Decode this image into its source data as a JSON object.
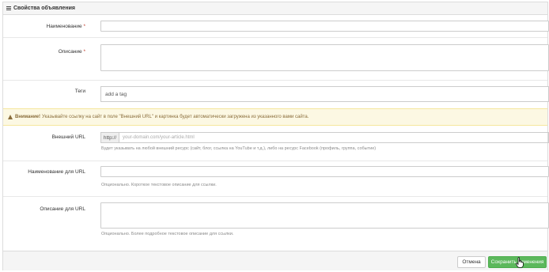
{
  "panel": {
    "title": "Свойства объявления"
  },
  "fields": {
    "name": {
      "label": "Наименование",
      "required_mark": "*",
      "value": ""
    },
    "description": {
      "label": "Описание",
      "required_mark": "*",
      "value": ""
    },
    "tags": {
      "label": "Теги",
      "placeholder": "add a tag"
    }
  },
  "alert": {
    "strong": "Внимание!",
    "text": "Указывайте ссылку на сайт в поле \"Внешний URL\" и картинка будет автоматически загружена из указанного вами сайта."
  },
  "external_url": {
    "label": "Внешний URL",
    "prefix": "http://",
    "placeholder": "your-domain.com/your-article.html",
    "help": "Будет указывать на любой внешний ресурс (сайт, блог, ссылка на YouTube и т.д.), либо на ресурс Facebook (профиль, группа, событие)"
  },
  "url_name": {
    "label": "Наименование для URL",
    "help": "Опционально. Короткое текстовое описание для ссылки."
  },
  "url_description": {
    "label": "Описание для URL",
    "help": "Опционально. Более подробное текстовое описание для ссылки."
  },
  "buttons": {
    "cancel": "Отмена",
    "save": "Сохранить изменения"
  },
  "colors": {
    "save_button": "#5cb85c",
    "alert_bg": "#fcf8e3",
    "alert_text": "#8a6d3b",
    "required": "#c0392b"
  }
}
